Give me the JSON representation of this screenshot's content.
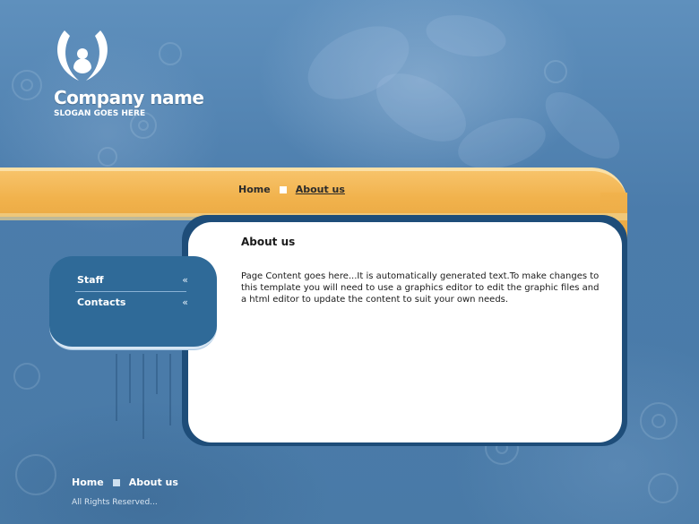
{
  "header": {
    "company_name": "Company name",
    "slogan": "SLOGAN GOES HERE",
    "logo_icon": "tulip-logo-icon"
  },
  "top_nav": {
    "items": [
      {
        "label": "Home",
        "active": false
      },
      {
        "label": "About us",
        "active": true
      }
    ]
  },
  "side_nav": {
    "items": [
      {
        "label": "Staff",
        "icon": "double-chevron-left-icon",
        "icon_glyph": "«"
      },
      {
        "label": "Contacts",
        "icon": "double-chevron-left-icon",
        "icon_glyph": "«"
      }
    ]
  },
  "content": {
    "title": "About us",
    "body": "Page Content goes here...It is automatically generated text.To make changes to this template you will need to use a graphics editor to edit the graphic files and a html editor to update the content to suit your own needs."
  },
  "footer": {
    "nav": [
      {
        "label": "Home"
      },
      {
        "label": "About us"
      }
    ],
    "copyright": "All Rights Reserved..."
  },
  "colors": {
    "background": "#4a7aa5",
    "band": "#f1b24c",
    "side_box": "#2f6a98",
    "panel": "#ffffff"
  }
}
